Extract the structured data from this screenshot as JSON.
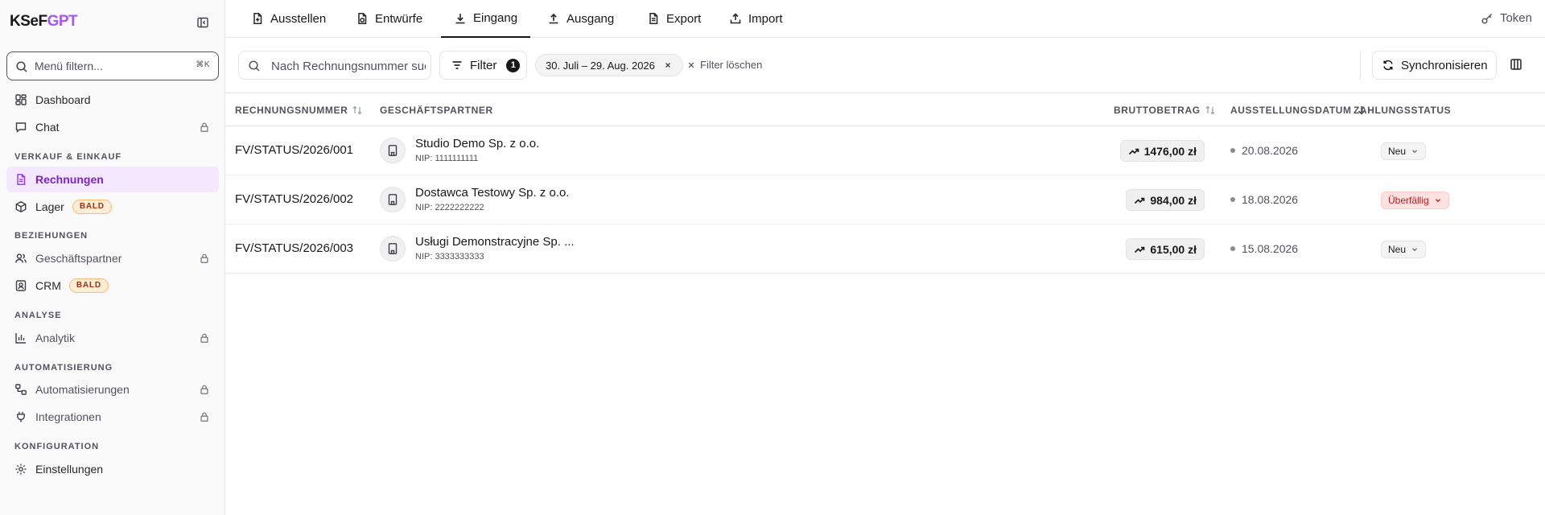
{
  "app": {
    "brand_part1": "KSeF",
    "brand_part2": "GPT"
  },
  "sidebar": {
    "search_placeholder": "Menü filtern...",
    "search_shortcut": "⌘K",
    "items": [
      {
        "label": "Dashboard",
        "icon": "grid-icon"
      },
      {
        "label": "Chat",
        "icon": "message-icon",
        "locked": true
      },
      {
        "section": "VERKAUF & EINKAUF"
      },
      {
        "label": "Rechnungen",
        "icon": "file-text-icon",
        "active": true
      },
      {
        "label": "Lager",
        "icon": "package-icon",
        "badge": "BALD"
      },
      {
        "section": "BEZIEHUNGEN"
      },
      {
        "label": "Geschäftspartner",
        "icon": "users-icon",
        "locked": true
      },
      {
        "label": "CRM",
        "icon": "contact-icon",
        "badge": "BALD"
      },
      {
        "section": "ANALYSE"
      },
      {
        "label": "Analytik",
        "icon": "bar-chart-icon",
        "locked": true
      },
      {
        "section": "AUTOMATISIERUNG"
      },
      {
        "label": "Automatisierungen",
        "icon": "workflow-icon",
        "locked": true
      },
      {
        "label": "Integrationen",
        "icon": "plug-icon",
        "locked": true
      },
      {
        "section": "KONFIGURATION"
      },
      {
        "label": "Einstellungen",
        "icon": "gear-icon"
      }
    ]
  },
  "tabs": [
    {
      "label": "Ausstellen",
      "icon": "file-plus-icon"
    },
    {
      "label": "Entwürfe",
      "icon": "draft-icon"
    },
    {
      "label": "Eingang",
      "icon": "download-icon",
      "active": true
    },
    {
      "label": "Ausgang",
      "icon": "upload-icon"
    },
    {
      "label": "Export",
      "icon": "file-export-icon"
    },
    {
      "label": "Import",
      "icon": "import-icon"
    }
  ],
  "token_label": "Token",
  "toolbar": {
    "search_placeholder": "Nach Rechnungsnummer suchen",
    "filter_label": "Filter",
    "filter_count": "1",
    "date_chip": "30. Juli – 29. Aug. 2026",
    "clear_filters": "Filter löschen",
    "sync_label": "Synchronisieren"
  },
  "table": {
    "columns": [
      "RECHNUNGSNUMMER",
      "GESCHÄFTSPARTNER",
      "BRUTTOBETRAG",
      "AUSSTELLUNGSDATUM",
      "ZAHLUNGSSTATUS"
    ],
    "rows": [
      {
        "number": "FV/STATUS/2026/001",
        "partner": "Studio Demo Sp. z o.o.",
        "nip": "NIP: 1111111111",
        "amount": "1476,00 zł",
        "date": "20.08.2026",
        "status": "Neu",
        "status_kind": "new"
      },
      {
        "number": "FV/STATUS/2026/002",
        "partner": "Dostawca Testowy Sp. z o.o.",
        "nip": "NIP: 2222222222",
        "amount": "984,00 zł",
        "date": "18.08.2026",
        "status": "Überfällig",
        "status_kind": "overdue"
      },
      {
        "number": "FV/STATUS/2026/003",
        "partner": "Usługi Demonstracyjne Sp. ...",
        "nip": "NIP: 3333333333",
        "amount": "615,00 zł",
        "date": "15.08.2026",
        "status": "Neu",
        "status_kind": "new"
      }
    ]
  },
  "colors": {
    "accent": "#a855f7",
    "active_nav_bg": "#f3e8ff",
    "overdue_bg": "#fee2e2",
    "overdue_text": "#b91c1c"
  }
}
